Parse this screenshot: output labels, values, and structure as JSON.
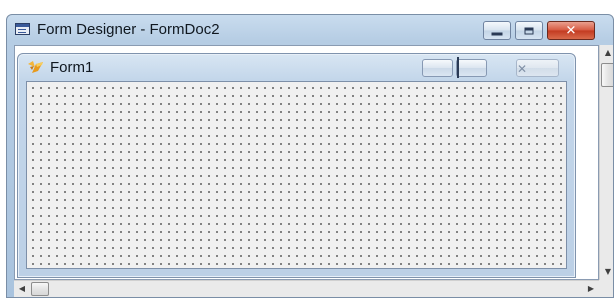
{
  "window": {
    "title": "Form Designer - FormDoc2",
    "icon": "form-designer-icon",
    "buttons": {
      "minimize": "minimize-icon",
      "maximize": "maximize-icon",
      "close": "close-icon"
    }
  },
  "form": {
    "title": "Form1",
    "icon": "form-icon",
    "buttons": {
      "minimize": "minimize-icon",
      "maximize": "maximize-icon",
      "close": "close-icon"
    }
  },
  "scrollbars": {
    "vertical": {
      "up": "▲",
      "down": "▼"
    },
    "horizontal": {
      "left": "◀",
      "right": "▶"
    }
  },
  "colors": {
    "window_frame": "#b6cde4",
    "close_button": "#d6583f",
    "design_surface": "#f0f0f0",
    "grid_dots": "#1e1e1e"
  }
}
